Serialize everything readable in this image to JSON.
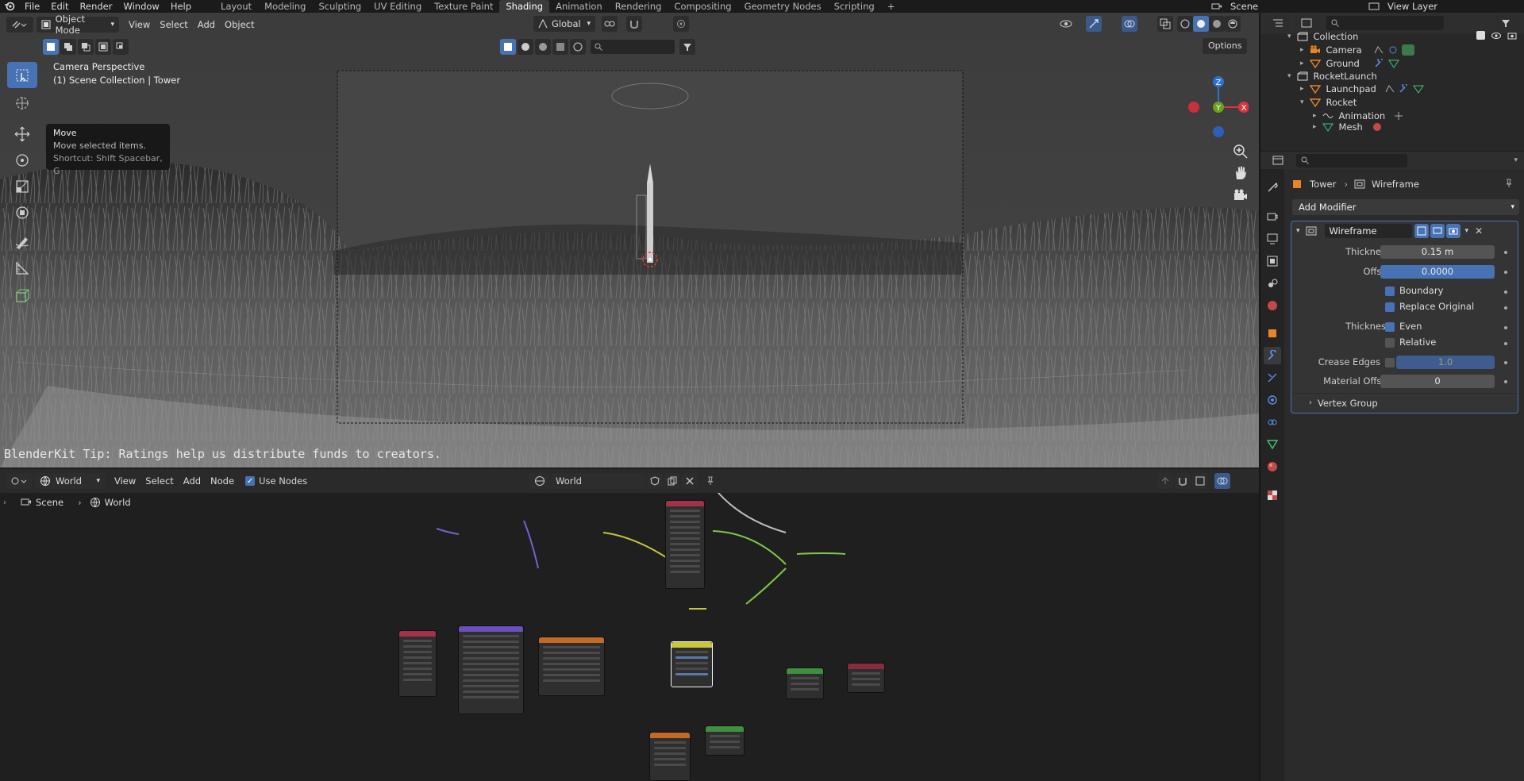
{
  "topbar": {
    "menus": [
      "File",
      "Edit",
      "Render",
      "Window",
      "Help"
    ],
    "workspaces": [
      "Layout",
      "Modeling",
      "Sculpting",
      "UV Editing",
      "Texture Paint",
      "Shading",
      "Animation",
      "Rendering",
      "Compositing",
      "Geometry Nodes",
      "Scripting"
    ],
    "active_workspace": "Shading",
    "scene_name": "Scene",
    "view_layer": "View Layer"
  },
  "viewport": {
    "mode": "Object Mode",
    "menus": [
      "View",
      "Select",
      "Add",
      "Object"
    ],
    "transform_orientation": "Global",
    "options_label": "Options",
    "overlay_title": "Camera Perspective",
    "overlay_subtitle": "(1) Scene Collection | Tower",
    "tooltip": {
      "title": "Move",
      "desc": "Move selected items.",
      "shortcut": "Shortcut: Shift Spacebar, G"
    },
    "tip_text": "BlenderKit Tip: Ratings help us distribute funds to creators.",
    "gizmo": {
      "x": "X",
      "y": "Y",
      "z": "Z"
    }
  },
  "node_editor": {
    "type": "World",
    "menus": [
      "View",
      "Select",
      "Add",
      "Node"
    ],
    "use_nodes_label": "Use Nodes",
    "use_nodes": true,
    "world_name": "World",
    "breadcrumb": [
      "Scene",
      "World"
    ]
  },
  "outliner": {
    "rows": [
      {
        "label": "Collection",
        "indent": 0,
        "icon": "collection-icon"
      },
      {
        "label": "Camera",
        "indent": 1,
        "icon": "camera-icon"
      },
      {
        "label": "Ground",
        "indent": 1,
        "icon": "mesh-icon"
      },
      {
        "label": "RocketLaunch",
        "indent": 0,
        "icon": "collection-icon"
      },
      {
        "label": "Launchpad",
        "indent": 1,
        "icon": "mesh-icon"
      },
      {
        "label": "Rocket",
        "indent": 1,
        "icon": "mesh-icon"
      },
      {
        "label": "Animation",
        "indent": 2,
        "icon": "animation-icon"
      },
      {
        "label": "Mesh",
        "indent": 2,
        "icon": "mesh-data-icon"
      }
    ]
  },
  "properties": {
    "breadcrumb_object": "Tower",
    "breadcrumb_modifier": "Wireframe",
    "add_modifier_label": "Add Modifier",
    "modifier_name": "Wireframe",
    "fields": {
      "thickness_label": "Thickness",
      "thickness_value": "0.15 m",
      "offset_label": "Offset",
      "offset_value": "0.0000",
      "boundary_label": "Boundary",
      "replace_original_label": "Replace Original",
      "thickness2_label": "Thickness",
      "even_label": "Even",
      "relative_label": "Relative",
      "crease_edges_label": "Crease Edges",
      "crease_value": "1.0",
      "material_offset_label": "Material Offset",
      "material_offset_value": "0",
      "vertex_group_label": "Vertex Group"
    },
    "checks": {
      "boundary": true,
      "replace_original": true,
      "even": true,
      "relative": false,
      "crease_edges": false
    }
  },
  "colors": {
    "accent": "#4772b3",
    "object_orange": "#e8842a",
    "gizmo_x": "#d8363f",
    "gizmo_y": "#6aa121",
    "gizmo_z": "#2f6fd6"
  }
}
